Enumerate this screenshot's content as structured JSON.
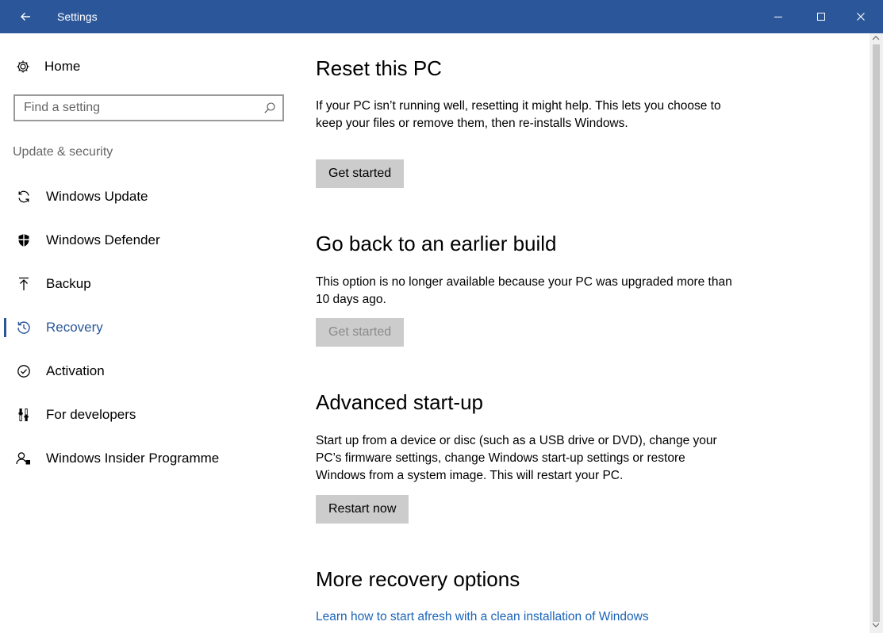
{
  "window": {
    "title": "Settings",
    "accent": "#2b579a"
  },
  "sidebar": {
    "home_label": "Home",
    "search_placeholder": "Find a setting",
    "section_label": "Update & security",
    "items": [
      {
        "label": "Windows Update",
        "icon": "refresh-icon"
      },
      {
        "label": "Windows Defender",
        "icon": "shield-icon"
      },
      {
        "label": "Backup",
        "icon": "upload-icon"
      },
      {
        "label": "Recovery",
        "icon": "history-icon",
        "active": true
      },
      {
        "label": "Activation",
        "icon": "check-circle-icon"
      },
      {
        "label": "For developers",
        "icon": "developer-tools-icon"
      },
      {
        "label": "Windows Insider Programme",
        "icon": "insider-icon"
      }
    ]
  },
  "main": {
    "reset": {
      "title": "Reset this PC",
      "description": "If your PC isn’t running well, resetting it might help. This lets you choose to keep your files or remove them, then re-installs Windows.",
      "button": "Get started"
    },
    "goback": {
      "title": "Go back to an earlier build",
      "description": "This option is no longer available because your PC was upgraded more than 10 days ago.",
      "button": "Get started"
    },
    "advanced": {
      "title": "Advanced start-up",
      "description": "Start up from a device or disc (such as a USB drive or DVD), change your PC’s firmware settings, change Windows start-up settings or restore Windows from a system image. This will restart your PC.",
      "button": "Restart now"
    },
    "more": {
      "title": "More recovery options",
      "link": "Learn how to start afresh with a clean installation of Windows"
    }
  }
}
